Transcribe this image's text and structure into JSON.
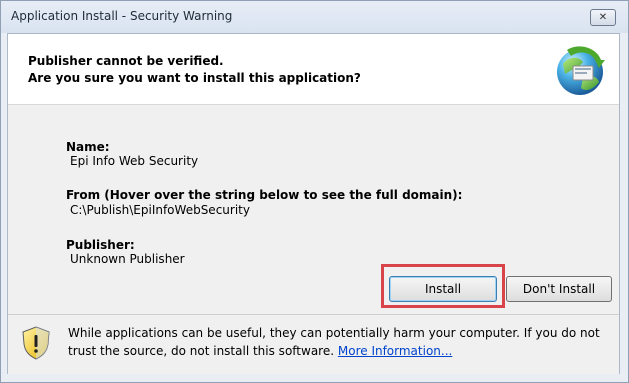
{
  "window": {
    "title": "Application Install - Security Warning",
    "close_glyph": "✕"
  },
  "header": {
    "line1": "Publisher cannot be verified.",
    "line2": "Are you sure you want to install this application?"
  },
  "details": {
    "name_label": "Name:",
    "name_value": "Epi Info Web Security",
    "from_label": "From (Hover over the string below to see the full domain):",
    "from_value": "C:\\Publish\\EpiInfoWebSecurity",
    "publisher_label": "Publisher:",
    "publisher_value": "Unknown Publisher"
  },
  "buttons": {
    "install": "Install",
    "dont_install": "Don't Install"
  },
  "footer": {
    "warning_text": "While applications can be useful, they can potentially harm your computer. If you do not trust the source, do not install this software.",
    "link_text": "More Information..."
  },
  "colors": {
    "highlight": "#d9434a",
    "link": "#0044cc"
  },
  "icons": {
    "header": "globe-install-icon",
    "footer": "warning-shield-icon"
  }
}
